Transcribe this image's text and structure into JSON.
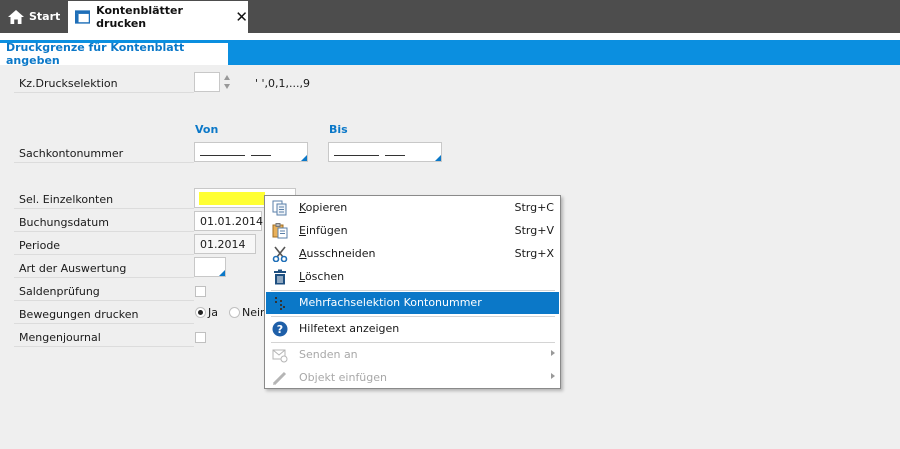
{
  "tabs": {
    "start_label": "Start",
    "active_label": "Kontenblätter drucken",
    "close_glyph": "✕"
  },
  "section": {
    "title": "Druckgrenze für Kontenblatt angeben"
  },
  "form": {
    "druckselektion": {
      "label": "Kz.Druckselektion",
      "hint": "' ',0,1,...,9",
      "value": ""
    },
    "range_headers": {
      "from": "Von",
      "to": "Bis"
    },
    "sachkontonummer": {
      "label": "Sachkontonummer",
      "from": "",
      "to": ""
    },
    "einzelkonten": {
      "label": "Sel. Einzelkonten",
      "highlight_color": "#ffff33"
    },
    "buchungsdatum": {
      "label": "Buchungsdatum",
      "value": "01.01.2014"
    },
    "periode": {
      "label": "Periode",
      "value": "01.2014"
    },
    "auswertung": {
      "label": "Art der Auswertung",
      "value": ""
    },
    "saldenpruefung": {
      "label": "Saldenprüfung",
      "checked": false
    },
    "bewegungen": {
      "label": "Bewegungen drucken",
      "options": [
        "Ja",
        "Nein"
      ],
      "selected": "Ja"
    },
    "mengenjournal": {
      "label": "Mengenjournal",
      "checked": false
    }
  },
  "context_menu": {
    "items": [
      {
        "label": "Kopieren",
        "shortcut": "Strg+C",
        "icon": "copy-icon",
        "enabled": true
      },
      {
        "label": "Einfügen",
        "shortcut": "Strg+V",
        "icon": "paste-icon",
        "enabled": true
      },
      {
        "label": "Ausschneiden",
        "shortcut": "Strg+X",
        "icon": "scissors-icon",
        "enabled": true
      },
      {
        "label": "Löschen",
        "shortcut": "",
        "icon": "trash-icon",
        "enabled": true
      },
      {
        "label": "Mehrfachselektion Kontonummer",
        "shortcut": "",
        "icon": "multiselect-icon",
        "enabled": true,
        "highlighted": true
      },
      {
        "label": "Hilfetext anzeigen",
        "shortcut": "",
        "icon": "help-icon",
        "enabled": true
      },
      {
        "label": "Senden an",
        "shortcut": "",
        "icon": "send-icon",
        "enabled": false,
        "submenu": true
      },
      {
        "label": "Objekt einfügen",
        "shortcut": "",
        "icon": "pen-icon",
        "enabled": false,
        "submenu": true
      }
    ]
  },
  "colors": {
    "accent": "#0b8fe0",
    "accent_text": "#0b78c8",
    "topbar": "#4d4d4d",
    "background": "#efefef",
    "menu_highlight": "#0b78c8"
  }
}
